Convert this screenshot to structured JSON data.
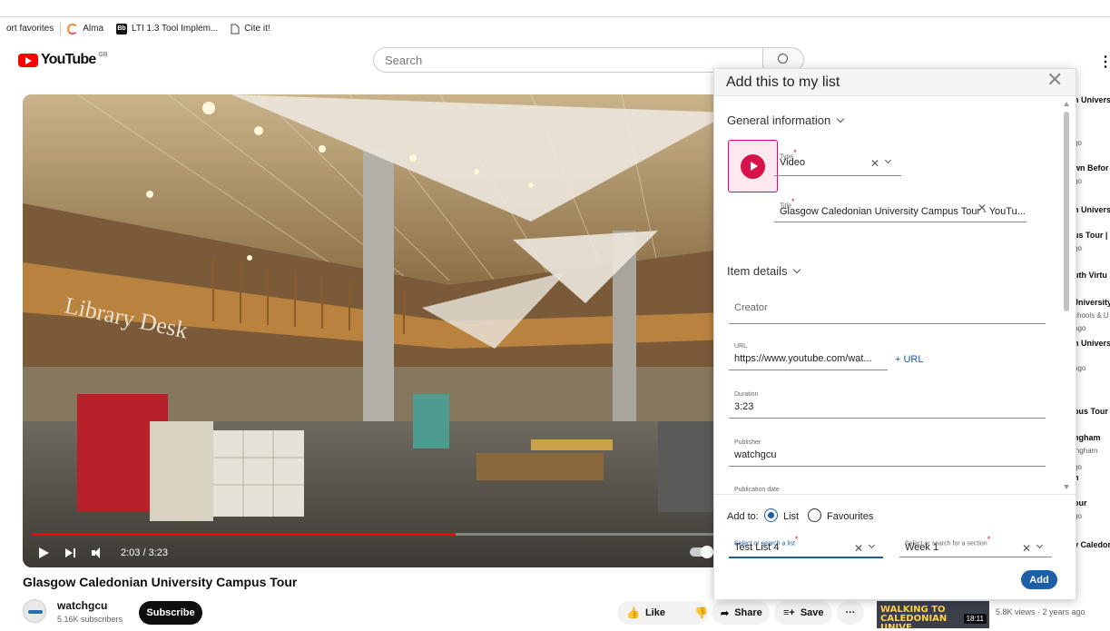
{
  "bookmarks": {
    "items": [
      {
        "label": "ort favorites"
      },
      {
        "label": "Alma"
      },
      {
        "label": "LTI 1.3 Tool Implem..."
      },
      {
        "label": "Cite it!"
      }
    ],
    "bb_badge": "Bb"
  },
  "masthead": {
    "logo_text": "YouTube",
    "region": "GB",
    "search_placeholder": "Search"
  },
  "player": {
    "time": "2:03 / 3:23",
    "progress_fraction": 0.615,
    "scene_text": "Library Desk"
  },
  "video": {
    "title": "Glasgow Caledonian University Campus Tour",
    "channel": "watchgcu",
    "subscribers": "5.16K subscribers",
    "subscribe_label": "Subscribe",
    "like_label": "Like",
    "share_label": "Share",
    "save_label": "Save",
    "more_label": "···"
  },
  "recommendations": {
    "lines": [
      {
        "text": "n Univers",
        "kind": "bold"
      },
      {
        "text": "go",
        "kind": "meta"
      },
      {
        "text": "wn Befor",
        "kind": "bold"
      },
      {
        "text": "go",
        "kind": "meta"
      },
      {
        "text": "n Univers",
        "kind": "bold"
      },
      {
        "text": "us Tour |",
        "kind": "bold"
      },
      {
        "text": "go",
        "kind": "meta"
      },
      {
        "text": "uth Virtu",
        "kind": "bold"
      },
      {
        "text": "Jniversity",
        "kind": "bold"
      },
      {
        "text": "chools & U",
        "kind": "meta"
      },
      {
        "text": "ago",
        "kind": "meta"
      },
      {
        "text": "n Univers",
        "kind": "bold"
      },
      {
        "text": "ago",
        "kind": "meta"
      },
      {
        "text": "pus Tour -",
        "kind": "bold"
      },
      {
        "text": "ngham",
        "kind": "bold"
      },
      {
        "text": "ingham",
        "kind": "meta"
      },
      {
        "text": "go",
        "kind": "meta"
      },
      {
        "text": "n",
        "kind": "bold"
      },
      {
        "text": "our",
        "kind": "bold"
      },
      {
        "text": "go",
        "kind": "meta"
      },
      {
        "text": "v Caledon",
        "kind": "bold"
      }
    ],
    "bottom_thumb_title": "WALKING TO CALEDONIAN UNIVE...",
    "bottom_thumb_duration": "18:11",
    "bottom_thumb_meta": "5.8K views · 2 years ago"
  },
  "modal": {
    "title": "Add this to my list",
    "general_heading": "General information",
    "type_label": "Type",
    "type_value": "Video",
    "title_label": "Title",
    "title_value": "Glasgow Caledonian University Campus Tour - YouTu...",
    "item_details_heading": "Item details",
    "creator_placeholder": "Creator",
    "url_label": "URL",
    "url_value": "https://www.youtube.com/wat...",
    "url_add": "+ URL",
    "duration_label": "Duration",
    "duration_value": "3:23",
    "publisher_label": "Publisher",
    "publisher_value": "watchgcu",
    "pubdate_label": "Publication date",
    "add_to_label": "Add to:",
    "radio_list": "List",
    "radio_favourites": "Favourites",
    "list_select_label": "Select or search a list",
    "list_select_value": "Test List 4",
    "section_select_label": "Select or search for a section",
    "section_select_value": "Week 1",
    "add_button": "Add",
    "required_mark": "*",
    "accent": "#1c5fa6",
    "type_color": "#d6134a"
  }
}
